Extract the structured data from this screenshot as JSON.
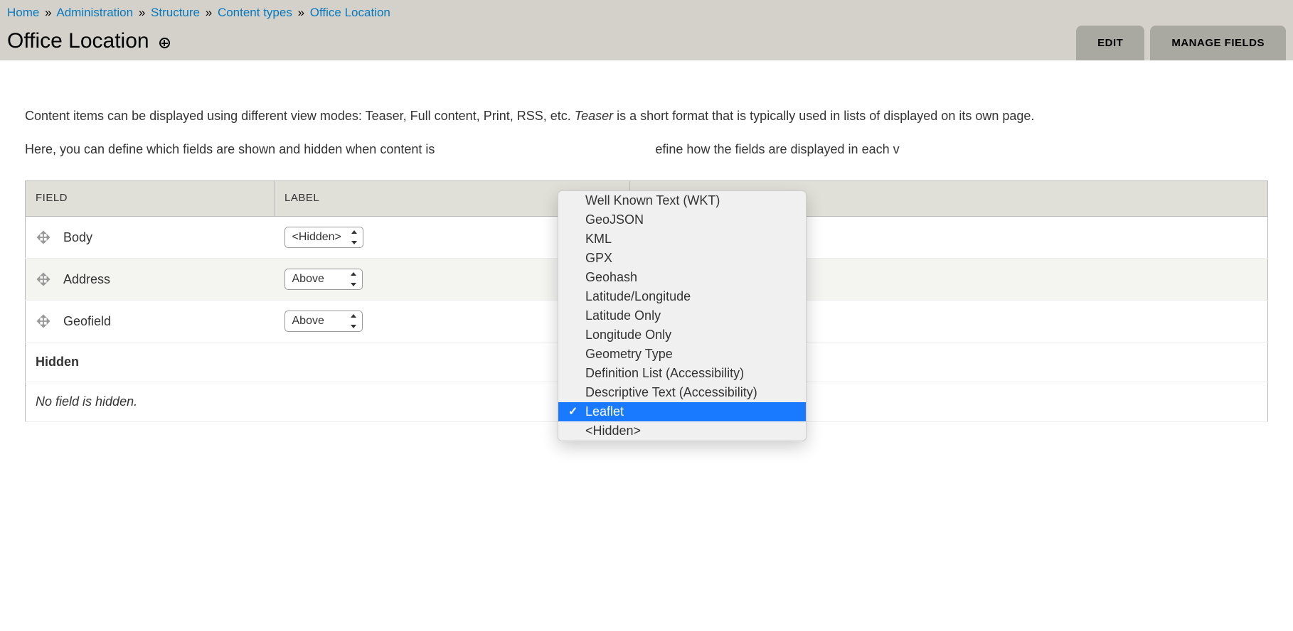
{
  "breadcrumb": {
    "home": "Home",
    "administration": "Administration",
    "structure": "Structure",
    "content_types": "Content types",
    "office_location": "Office Location",
    "separator": "»"
  },
  "page_title": "Office Location",
  "tabs": {
    "edit": "EDIT",
    "manage_fields": "MANAGE FIELDS"
  },
  "description": {
    "p1_a": "Content items can be displayed using different view modes: Teaser, Full content, Print, RSS, etc. ",
    "p1_em": "Teaser",
    "p1_b": " is a short format that is typically used in lists of displayed on its own page.",
    "p2_a": "Here, you can define which fields are shown and hidden when content is ",
    "p2_b": "efine how the fields are displayed in each v"
  },
  "table": {
    "headers": {
      "field": "FIELD",
      "label": "LABEL"
    },
    "rows": {
      "body": {
        "name": "Body",
        "label_select": "<Hidden>"
      },
      "address": {
        "name": "Address",
        "label_select": "Above"
      },
      "geofield": {
        "name": "Geofield",
        "label_select": "Above"
      }
    },
    "hidden_title": "Hidden",
    "hidden_text": "No field is hidden."
  },
  "dropdown": {
    "options": [
      "Well Known Text (WKT)",
      "GeoJSON",
      "KML",
      "GPX",
      "Geohash",
      "Latitude/Longitude",
      "Latitude Only",
      "Longitude Only",
      "Geometry Type",
      "Definition List (Accessibility)",
      "Descriptive Text (Accessibility)",
      "Leaflet",
      "<Hidden>"
    ],
    "selected_index": 11
  }
}
